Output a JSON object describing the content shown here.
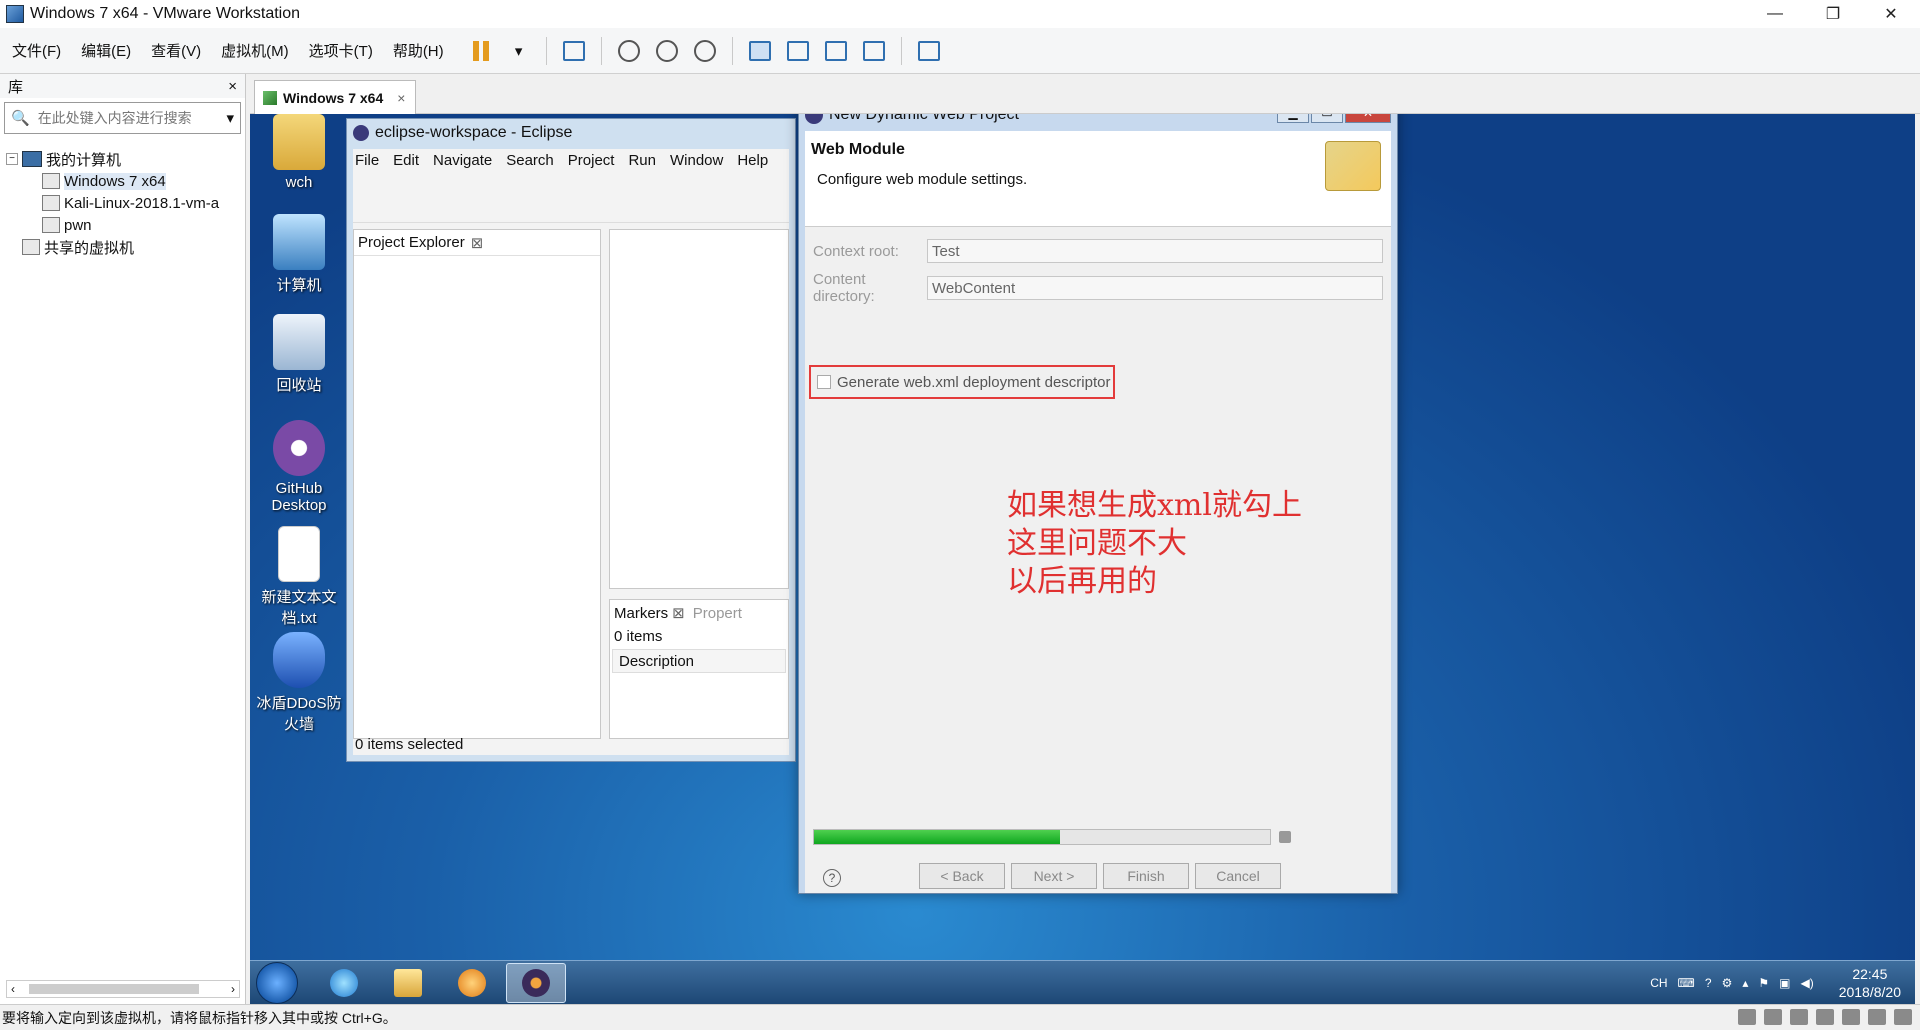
{
  "window": {
    "title": "Windows 7 x64 - VMware Workstation",
    "controls": [
      "—",
      "❐",
      "✕"
    ]
  },
  "menubar": {
    "items": [
      "文件(F)",
      "编辑(E)",
      "查看(V)",
      "虚拟机(M)",
      "选项卡(T)",
      "帮助(H)"
    ]
  },
  "library": {
    "title": "库",
    "close": "×",
    "search_placeholder": "在此处键入内容进行搜索",
    "tree": {
      "root": "我的计算机",
      "vms": [
        "Windows 7 x64",
        "Kali-Linux-2018.1-vm-a",
        "pwn"
      ],
      "shared": "共享的虚拟机"
    }
  },
  "vm_tab": {
    "label": "Windows 7 x64",
    "close": "×"
  },
  "desktop_icons": [
    {
      "label": "wch"
    },
    {
      "label": "计算机"
    },
    {
      "label": "回收站"
    },
    {
      "label": "GitHub Desktop"
    },
    {
      "label": "新建文本文档.txt"
    },
    {
      "label": "冰盾DDoS防火墙"
    }
  ],
  "eclipse": {
    "title": "eclipse-workspace - Eclipse",
    "menu": [
      "File",
      "Edit",
      "Navigate",
      "Search",
      "Project",
      "Run",
      "Window",
      "Help"
    ],
    "project_explorer": "Project Explorer",
    "markers_tab": "Markers",
    "properties_tab": "Propert",
    "markers_count": "0 items",
    "markers_column": "Description",
    "status": "0 items selected"
  },
  "dialog": {
    "title": "New Dynamic Web Project",
    "heading": "Web Module",
    "subtitle": "Configure web module settings.",
    "context_root_label": "Context root:",
    "context_root_value": "Test",
    "content_dir_label": "Content directory:",
    "content_dir_value": "WebContent",
    "generate_label": "Generate web.xml deployment descriptor",
    "generate_checked": false,
    "annotation": [
      "如果想生成xml就勾上",
      "这里问题不大",
      "以后再用的"
    ],
    "progress": 0.54,
    "buttons": {
      "back": "< Back",
      "next": "Next >",
      "finish": "Finish",
      "cancel": "Cancel"
    },
    "help": "?"
  },
  "tray": {
    "lang": "CH",
    "time": "22:45",
    "date": "2018/8/20"
  },
  "vm_status": "要将输入定向到该虚拟机，请将鼠标指针移入其中或按 Ctrl+G。",
  "colors": {
    "annotation": "#e03030",
    "highlight_box": "#e33b3b",
    "progress": "#0fa71f"
  }
}
